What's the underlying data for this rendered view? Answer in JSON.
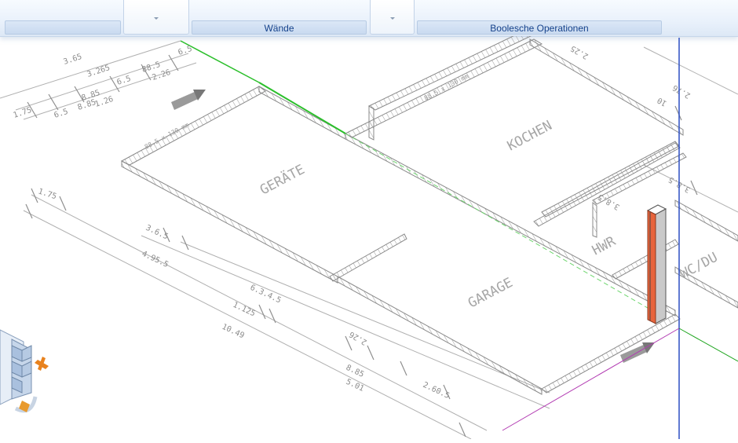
{
  "ribbon": {
    "groups": [
      {
        "label": "Wände"
      },
      {
        "label": "Boolesche Operationen"
      }
    ]
  },
  "viewport": {
    "room_labels": [
      "GERÄTE",
      "KOCHEN",
      "GARAGE",
      "HWR",
      "WC/DU"
    ],
    "dimension_labels": [
      "3.65",
      "3.265",
      "6.5",
      "6.5",
      "88.5",
      "2.26",
      "6.5",
      "8.85",
      "1.26",
      "8.85",
      "2.26",
      "1.75",
      "1.75",
      "3.6.5",
      "4.95.5",
      "6.3.4.5",
      "1.125",
      "10.49",
      "2.26",
      "8.85",
      "5.01",
      "2.60.5",
      "2.25",
      "10",
      "2.76",
      "3.8.5",
      "3.8.5"
    ],
    "wall_notes": [
      "88.5 x 130 mm",
      "88.5 x 130 mm"
    ],
    "axis_colors": {
      "x": "#1fa51f",
      "y": "#2b4fc4",
      "z": "#b23bb2",
      "selection": "#e8643c"
    }
  }
}
